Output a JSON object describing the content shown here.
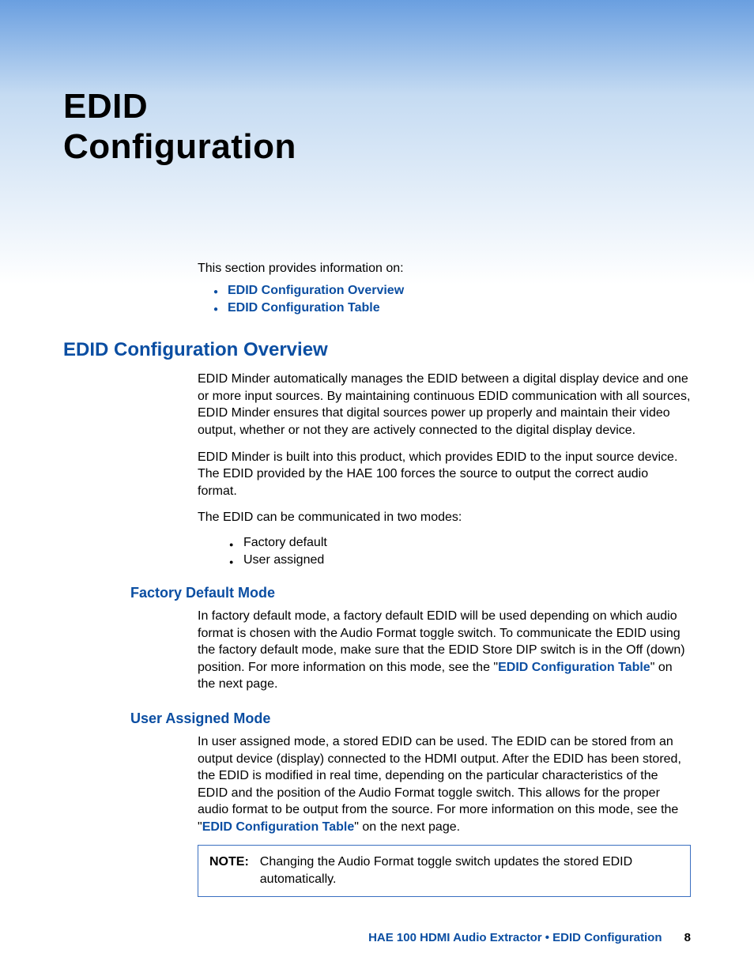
{
  "title": "EDID\nConfiguration",
  "intro": {
    "lead": "This section provides information on:",
    "toc": [
      "EDID Configuration Overview",
      "EDID Configuration Table"
    ]
  },
  "section_overview": {
    "heading": "EDID Configuration Overview",
    "p1": "EDID Minder automatically manages the EDID between a digital display device and one or more input sources. By maintaining continuous EDID communication with all sources, EDID Minder ensures that digital sources power up properly and maintain their video output, whether or not they are actively connected to the digital display device.",
    "p2": "EDID Minder is built into this product, which provides EDID to the input source device. The EDID provided by the HAE 100 forces the source to output the correct audio format.",
    "p3": "The EDID can be communicated in two modes:",
    "modes": [
      "Factory default",
      "User assigned"
    ]
  },
  "section_factory": {
    "heading": "Factory Default Mode",
    "p1_pre": "In factory default mode, a factory default EDID will be used depending on which audio format is chosen with the Audio Format toggle switch. To communicate the EDID using the factory default mode, make sure that the EDID Store DIP switch is in the Off (down) position. For more information on this mode, see the \"",
    "p1_link": "EDID Configuration Table",
    "p1_post": "\" on the next page."
  },
  "section_user": {
    "heading": "User Assigned Mode",
    "p1_pre": "In user assigned mode, a stored EDID can be used. The EDID can be stored from an output device (display) connected to the HDMI output. After the EDID has been stored, the EDID is modified in real time, depending on the particular characteristics of the EDID and the position of the Audio Format toggle switch. This allows for the proper audio format to be output from the source. For more information on this mode, see the \"",
    "p1_link": "EDID Configuration Table",
    "p1_post": "\" on the next page."
  },
  "note": {
    "label": "NOTE:",
    "text": "Changing the Audio Format toggle switch updates the stored EDID automatically."
  },
  "footer": {
    "doc_title": "HAE 100 HDMI Audio Extractor • EDID Configuration",
    "page_number": "8"
  }
}
